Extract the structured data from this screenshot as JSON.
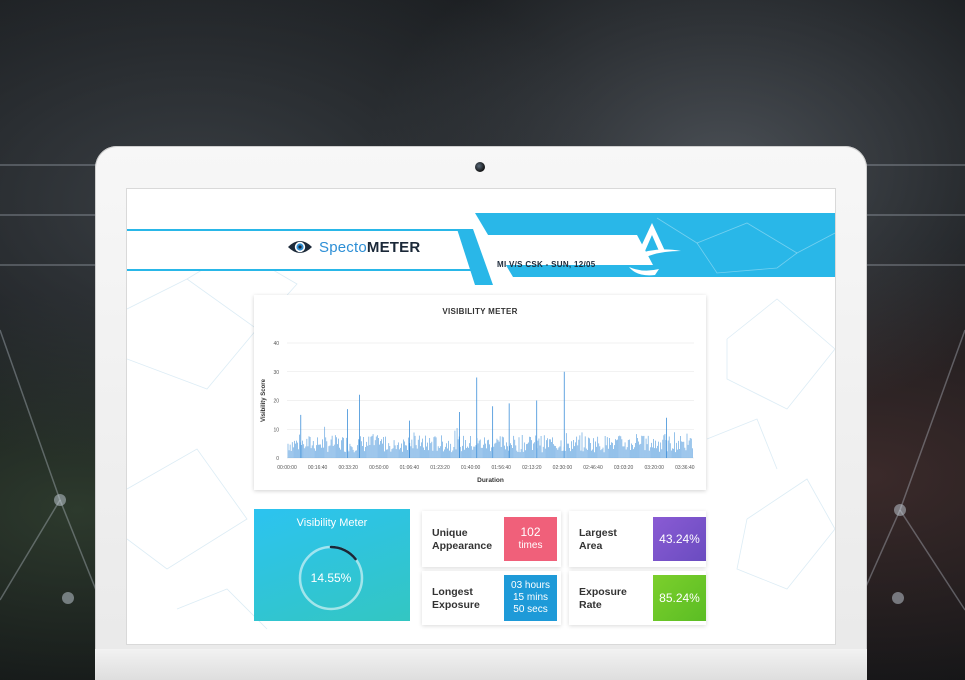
{
  "header": {
    "logo_prefix": "Specto",
    "logo_suffix": "METER",
    "match": "MI V/S CSK - SUN, 12/05"
  },
  "chart": {
    "title": "VISIBILITY METER"
  },
  "chart_data": {
    "type": "bar",
    "title": "VISIBILITY METER",
    "xlabel": "Duration",
    "ylabel": "Visibility Score",
    "ylim": [
      0,
      40
    ],
    "yticks": [
      "0",
      "10",
      "20",
      "30",
      "40"
    ],
    "xticks": [
      "00:00:00",
      "00:16:40",
      "00:33:20",
      "00:50:00",
      "01:06:40",
      "01:23:20",
      "01:40:00",
      "01:56:40",
      "02:13:20",
      "02:30:00",
      "02:46:40",
      "03:03:20",
      "03:20:00",
      "03:36:40"
    ],
    "x_range_seconds": [
      0,
      13300
    ],
    "grid": true,
    "bar_color": "#3d8fd9",
    "peaks": [
      {
        "x": "00:07:30",
        "y": 15
      },
      {
        "x": "00:33:00",
        "y": 17
      },
      {
        "x": "00:39:30",
        "y": 22
      },
      {
        "x": "01:06:40",
        "y": 13
      },
      {
        "x": "01:34:00",
        "y": 16
      },
      {
        "x": "01:43:20",
        "y": 28
      },
      {
        "x": "01:52:00",
        "y": 18
      },
      {
        "x": "02:01:00",
        "y": 19
      },
      {
        "x": "02:16:00",
        "y": 20
      },
      {
        "x": "02:31:00",
        "y": 30
      },
      {
        "x": "03:26:40",
        "y": 14
      }
    ],
    "baseline_range": [
      2,
      8
    ]
  },
  "visibility_meter": {
    "title": "Visibility Meter",
    "value": "14.55%",
    "fraction": 0.1455
  },
  "stats": {
    "unique_label": "Unique Appearance",
    "unique_line1": "102",
    "unique_line2": "times",
    "largest_label": "Largest Area",
    "largest_value": "43.24%",
    "longest_label": "Longest Exposure",
    "longest_line1": "03 hours",
    "longest_line2": "15 mins",
    "longest_line3": "50 secs",
    "rate_label": "Exposure Rate",
    "rate_value": "85.24%"
  },
  "colors": {
    "accent": "#29b7e8",
    "unique_tile": "#f0607a",
    "largest_tile": "#7a55c9",
    "longest_tile": "#1e9ad8",
    "rate_tile": "#6cc629"
  }
}
